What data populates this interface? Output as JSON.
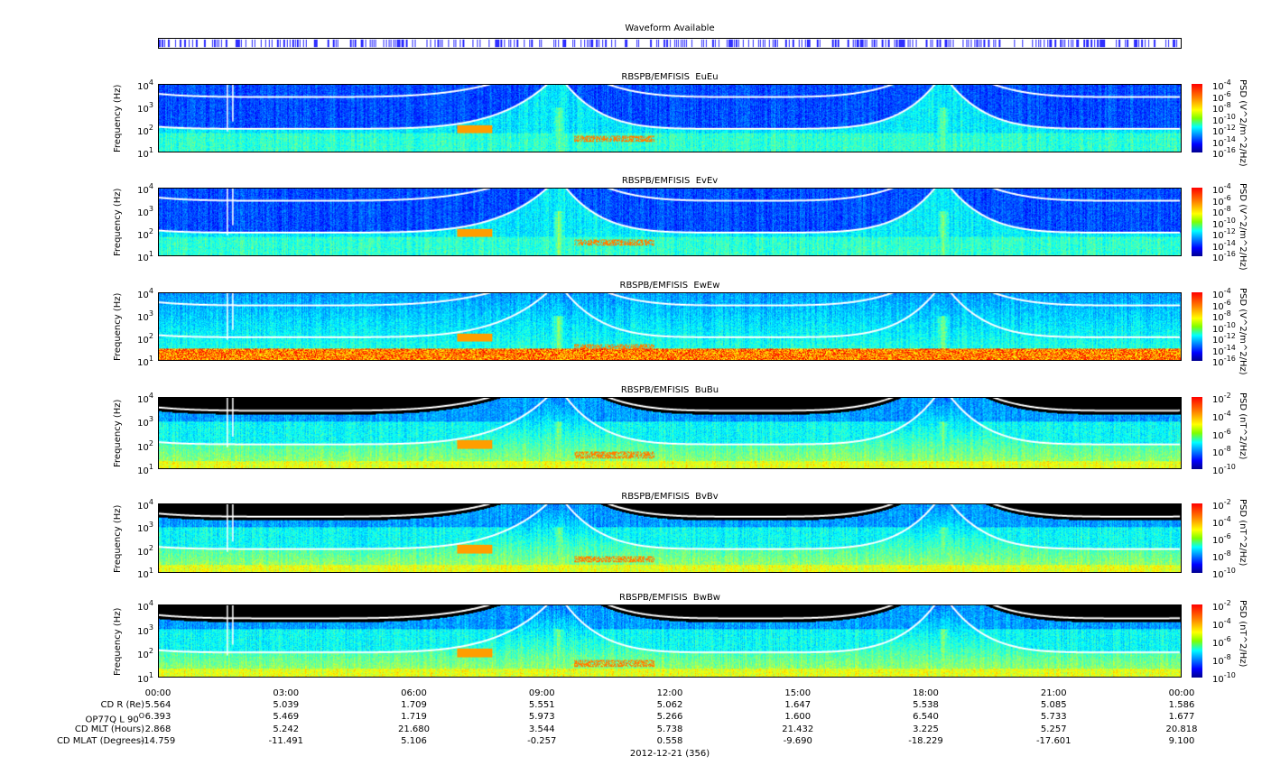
{
  "waveform": {
    "title": "Waveform Available"
  },
  "chart_data": {
    "type": "heatmap",
    "x_axis": {
      "ticks": [
        "00:00",
        "03:00",
        "06:00",
        "09:00",
        "12:00",
        "15:00",
        "18:00",
        "21:00",
        "00:00"
      ],
      "date_label": "2012-12-21 (356)"
    },
    "y_axis": {
      "label": "Frequency (Hz)",
      "scale": "log",
      "range": [
        10,
        10000
      ],
      "ticks": [
        "1",
        "2",
        "3",
        "4"
      ]
    },
    "panels": [
      {
        "title": "RBSPB/EMFISIS  EuEu",
        "type": "E",
        "cbar_label": "PSD (V^2/m^2/Hz)",
        "cbar_ticks": [
          "-4",
          "-6",
          "-8",
          "-10",
          "-12",
          "-14",
          "-16"
        ]
      },
      {
        "title": "RBSPB/EMFISIS  EvEv",
        "type": "E",
        "cbar_label": "PSD (V^2/m^2/Hz)",
        "cbar_ticks": [
          "-4",
          "-6",
          "-8",
          "-10",
          "-12",
          "-14",
          "-16"
        ]
      },
      {
        "title": "RBSPB/EMFISIS  EwEw",
        "type": "Ew",
        "cbar_label": "PSD (V^2/m^2/Hz)",
        "cbar_ticks": [
          "-4",
          "-6",
          "-8",
          "-10",
          "-12",
          "-14",
          "-16"
        ]
      },
      {
        "title": "RBSPB/EMFISIS  BuBu",
        "type": "B",
        "cbar_label": "PSD (nT^2/Hz)",
        "cbar_ticks": [
          "-2",
          "-4",
          "-6",
          "-8",
          "-10"
        ]
      },
      {
        "title": "RBSPB/EMFISIS  BvBv",
        "type": "B",
        "cbar_label": "PSD (nT^2/Hz)",
        "cbar_ticks": [
          "-2",
          "-4",
          "-6",
          "-8",
          "-10"
        ]
      },
      {
        "title": "RBSPB/EMFISIS  BwBw",
        "type": "B",
        "cbar_label": "PSD (nT^2/Hz)",
        "cbar_ticks": [
          "-2",
          "-4",
          "-6",
          "-8",
          "-10"
        ]
      }
    ]
  },
  "ephemeris": {
    "rows": [
      {
        "label": "CD R (Re)",
        "values": [
          "5.564",
          "5.039",
          "1.709",
          "5.551",
          "5.062",
          "1.647",
          "5.538",
          "5.085",
          "1.586"
        ]
      },
      {
        "label": "OP77Q L 90",
        "sup": "O",
        "values": [
          "6.393",
          "5.469",
          "1.719",
          "5.973",
          "5.266",
          "1.600",
          "6.540",
          "5.733",
          "1.677"
        ]
      },
      {
        "label": "CD MLT (Hours)",
        "values": [
          "2.868",
          "5.242",
          "21.680",
          "3.544",
          "5.738",
          "21.432",
          "3.225",
          "5.257",
          "20.818"
        ]
      },
      {
        "label": "CD MLAT (Degrees)",
        "values": [
          "-14.759",
          "-11.491",
          "5.106",
          "-0.257",
          "0.558",
          "-9.690",
          "-18.229",
          "-17.601",
          "9.100"
        ]
      }
    ]
  }
}
